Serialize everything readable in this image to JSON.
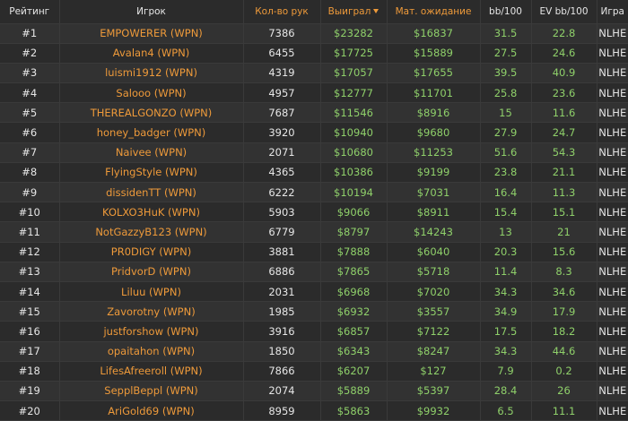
{
  "colors": {
    "background": "#2b2b2b",
    "row_alt": "#323232",
    "accent": "#ee9a3a",
    "positive": "#8fd06a",
    "text": "#e6e6e6"
  },
  "headers": {
    "rank": "Рейтинг",
    "player": "Игрок",
    "hands": "Кол-во рук",
    "won": "Выиграл",
    "ev": "Мат. ожидание",
    "bb100": "bb/100",
    "evbb100": "EV bb/100",
    "game": "Игра"
  },
  "sort": {
    "column": "won",
    "direction": "desc",
    "icon": "sort-desc-icon"
  },
  "rows": [
    {
      "rank": "#1",
      "player": "EMPOWERER (WPN)",
      "hands": "7386",
      "won": "$23282",
      "ev": "$16837",
      "bb100": "31.5",
      "evbb100": "22.8",
      "game": "NLHE"
    },
    {
      "rank": "#2",
      "player": "Avalan4 (WPN)",
      "hands": "6455",
      "won": "$17725",
      "ev": "$15889",
      "bb100": "27.5",
      "evbb100": "24.6",
      "game": "NLHE"
    },
    {
      "rank": "#3",
      "player": "luismi1912 (WPN)",
      "hands": "4319",
      "won": "$17057",
      "ev": "$17655",
      "bb100": "39.5",
      "evbb100": "40.9",
      "game": "NLHE"
    },
    {
      "rank": "#4",
      "player": "Salooo (WPN)",
      "hands": "4957",
      "won": "$12777",
      "ev": "$11701",
      "bb100": "25.8",
      "evbb100": "23.6",
      "game": "NLHE"
    },
    {
      "rank": "#5",
      "player": "THEREALGONZO (WPN)",
      "hands": "7687",
      "won": "$11546",
      "ev": "$8916",
      "bb100": "15",
      "evbb100": "11.6",
      "game": "NLHE"
    },
    {
      "rank": "#6",
      "player": "honey_badger (WPN)",
      "hands": "3920",
      "won": "$10940",
      "ev": "$9680",
      "bb100": "27.9",
      "evbb100": "24.7",
      "game": "NLHE"
    },
    {
      "rank": "#7",
      "player": "Naivee (WPN)",
      "hands": "2071",
      "won": "$10680",
      "ev": "$11253",
      "bb100": "51.6",
      "evbb100": "54.3",
      "game": "NLHE"
    },
    {
      "rank": "#8",
      "player": "FlyingStyle (WPN)",
      "hands": "4365",
      "won": "$10386",
      "ev": "$9199",
      "bb100": "23.8",
      "evbb100": "21.1",
      "game": "NLHE"
    },
    {
      "rank": "#9",
      "player": "dissidenTT (WPN)",
      "hands": "6222",
      "won": "$10194",
      "ev": "$7031",
      "bb100": "16.4",
      "evbb100": "11.3",
      "game": "NLHE"
    },
    {
      "rank": "#10",
      "player": "KOLXO3HuK (WPN)",
      "hands": "5903",
      "won": "$9066",
      "ev": "$8911",
      "bb100": "15.4",
      "evbb100": "15.1",
      "game": "NLHE"
    },
    {
      "rank": "#11",
      "player": "NotGazzyB123 (WPN)",
      "hands": "6779",
      "won": "$8797",
      "ev": "$14243",
      "bb100": "13",
      "evbb100": "21",
      "game": "NLHE"
    },
    {
      "rank": "#12",
      "player": "PR0DIGY (WPN)",
      "hands": "3881",
      "won": "$7888",
      "ev": "$6040",
      "bb100": "20.3",
      "evbb100": "15.6",
      "game": "NLHE"
    },
    {
      "rank": "#13",
      "player": "PridvorD (WPN)",
      "hands": "6886",
      "won": "$7865",
      "ev": "$5718",
      "bb100": "11.4",
      "evbb100": "8.3",
      "game": "NLHE"
    },
    {
      "rank": "#14",
      "player": "Liluu (WPN)",
      "hands": "2031",
      "won": "$6968",
      "ev": "$7020",
      "bb100": "34.3",
      "evbb100": "34.6",
      "game": "NLHE"
    },
    {
      "rank": "#15",
      "player": "Zavorotny (WPN)",
      "hands": "1985",
      "won": "$6932",
      "ev": "$3557",
      "bb100": "34.9",
      "evbb100": "17.9",
      "game": "NLHE"
    },
    {
      "rank": "#16",
      "player": "justforshow (WPN)",
      "hands": "3916",
      "won": "$6857",
      "ev": "$7122",
      "bb100": "17.5",
      "evbb100": "18.2",
      "game": "NLHE"
    },
    {
      "rank": "#17",
      "player": "opaitahon (WPN)",
      "hands": "1850",
      "won": "$6343",
      "ev": "$8247",
      "bb100": "34.3",
      "evbb100": "44.6",
      "game": "NLHE"
    },
    {
      "rank": "#18",
      "player": "LifesAfreeroll (WPN)",
      "hands": "7866",
      "won": "$6207",
      "ev": "$127",
      "bb100": "7.9",
      "evbb100": "0.2",
      "game": "NLHE"
    },
    {
      "rank": "#19",
      "player": "SepplBeppl (WPN)",
      "hands": "2074",
      "won": "$5889",
      "ev": "$5397",
      "bb100": "28.4",
      "evbb100": "26",
      "game": "NLHE"
    },
    {
      "rank": "#20",
      "player": "AriGold69 (WPN)",
      "hands": "8959",
      "won": "$5863",
      "ev": "$9932",
      "bb100": "6.5",
      "evbb100": "11.1",
      "game": "NLHE"
    }
  ]
}
